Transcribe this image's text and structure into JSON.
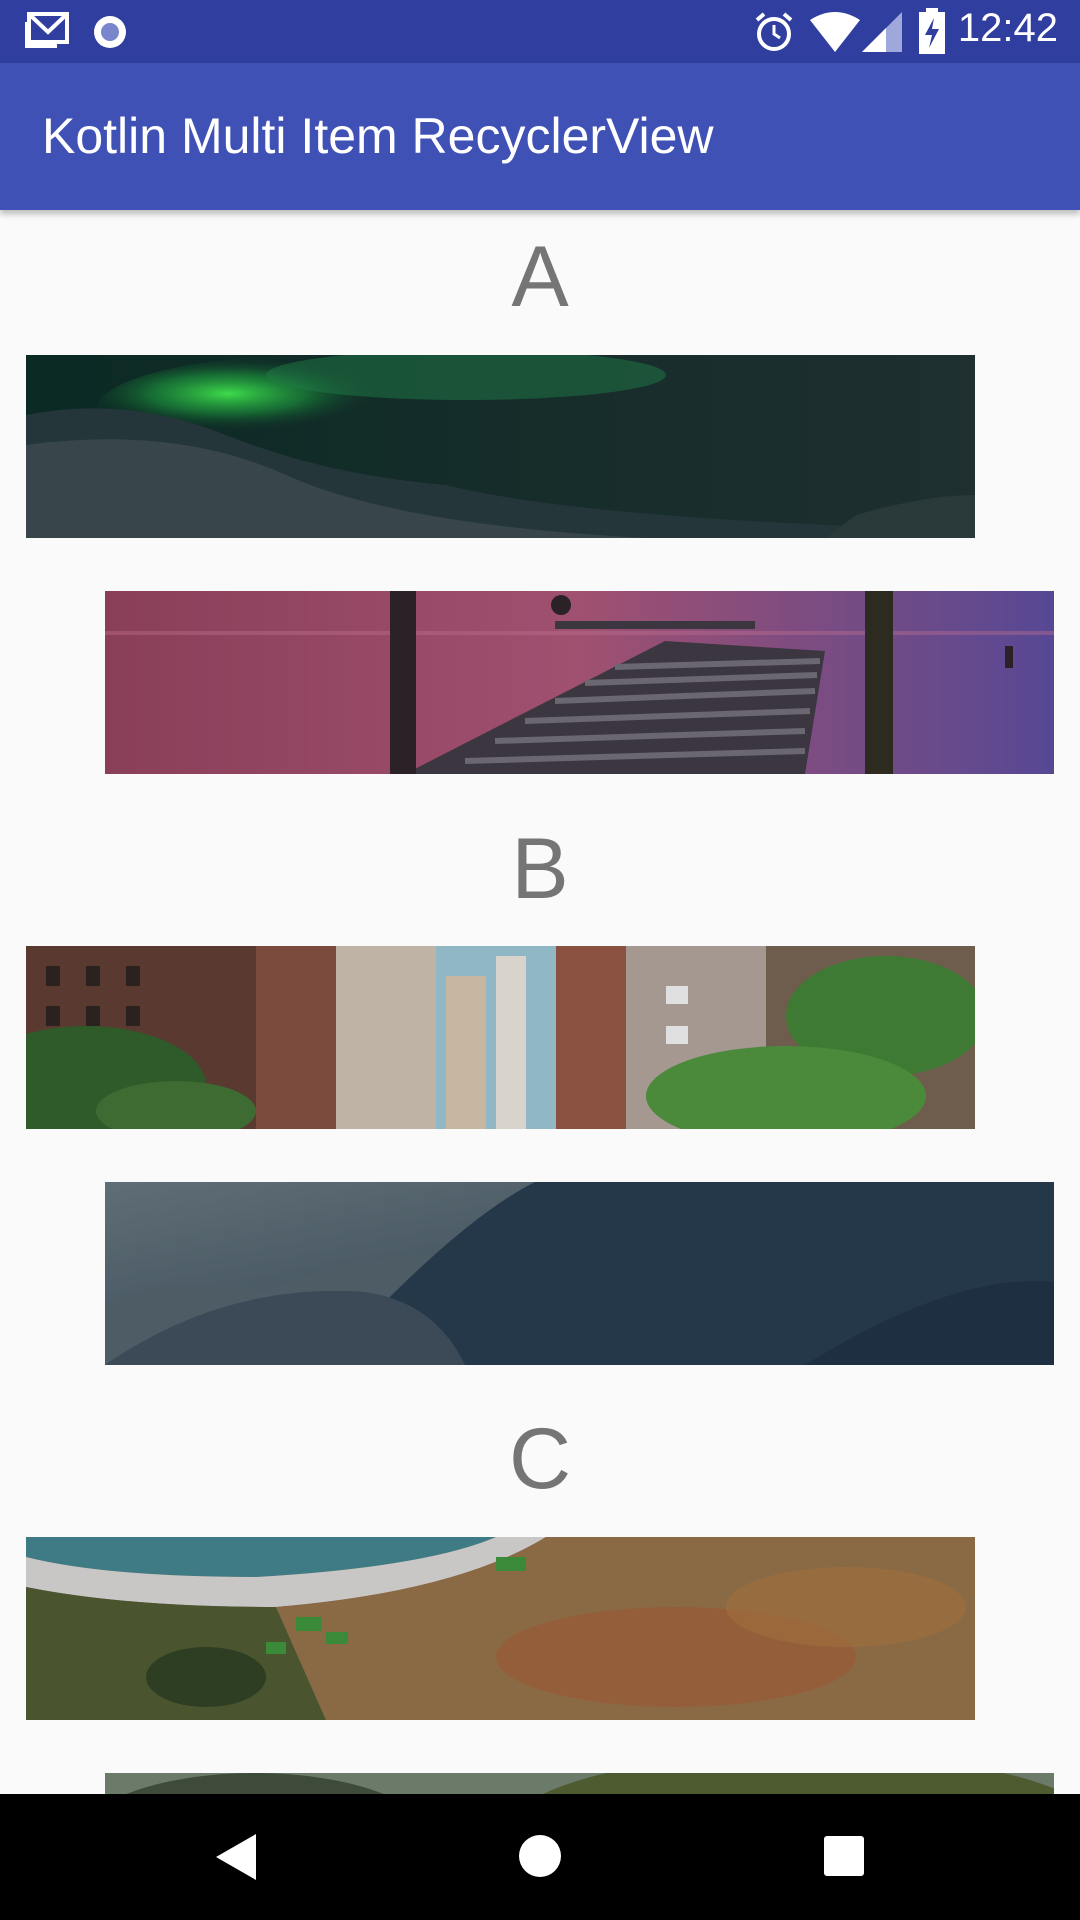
{
  "status_bar": {
    "time": "12:42",
    "left_icons": [
      "gmail-icon",
      "record-icon"
    ],
    "right_icons": [
      "alarm-icon",
      "wifi-icon",
      "signal-icon",
      "battery-charging-icon"
    ]
  },
  "app_bar": {
    "title": "Kotlin Multi Item RecyclerView",
    "color": "#3f51b5"
  },
  "list": {
    "sections": [
      {
        "header": "A",
        "images": [
          "aurora-image",
          "pier-image"
        ]
      },
      {
        "header": "B",
        "images": [
          "city-street-image",
          "misty-mountains-image"
        ]
      },
      {
        "header": "C",
        "images": [
          "coastal-hillside-image",
          "forest-valley-image"
        ]
      }
    ]
  },
  "nav_bar": {
    "buttons": [
      "back-icon",
      "home-icon",
      "recents-icon"
    ]
  }
}
